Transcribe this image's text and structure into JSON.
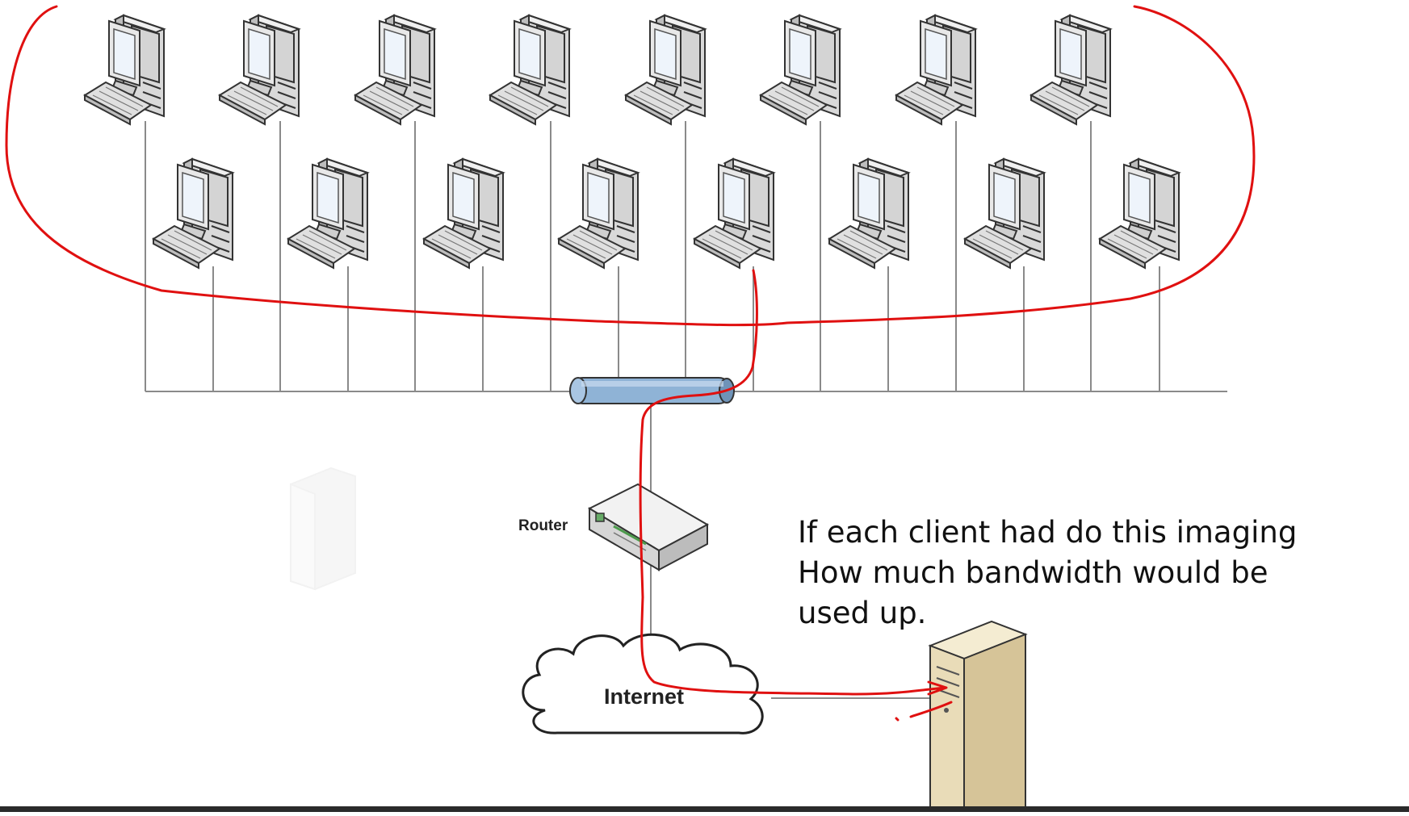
{
  "diagram": {
    "router_label": "Router",
    "internet_label": "Internet",
    "note_lines": [
      "If each client had do this imaging",
      "How much bandwidth would be",
      "used up."
    ],
    "client_count": 16,
    "icons": [
      "workstation-icon",
      "hub-icon",
      "router-icon",
      "cloud-icon",
      "server-icon"
    ],
    "colors": {
      "annotation_red": "#e01010",
      "hub_blue": "#8fb3d6",
      "server_beige": "#e9dcb8",
      "line_gray": "#8a8a8a"
    }
  }
}
